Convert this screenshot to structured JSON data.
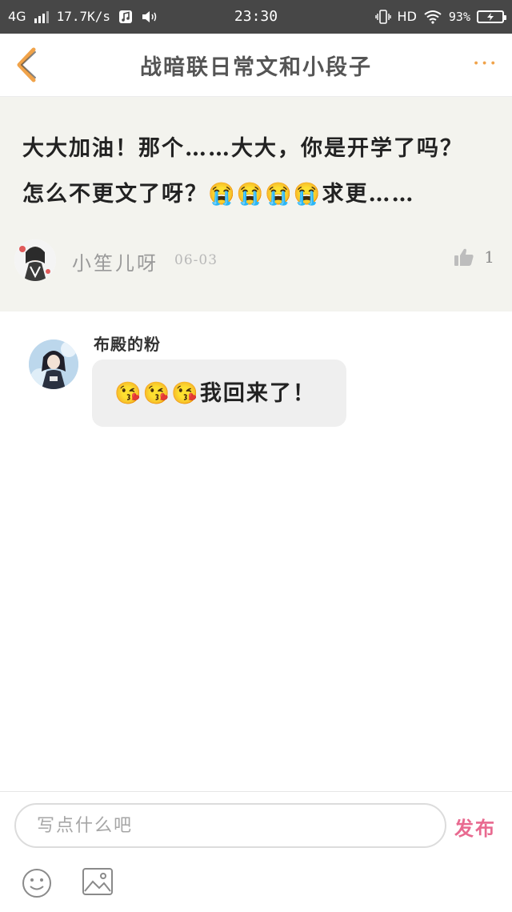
{
  "status_bar": {
    "network": "4G",
    "speed": "17.7K/s",
    "time": "23:30",
    "hd": "HD",
    "battery": "93%"
  },
  "header": {
    "title": "战暗联日常文和小段子",
    "more_label": "···"
  },
  "post": {
    "text_line1": "大大加油！那个……大大，你是开学了吗？",
    "text_line2": "怎么不更文了呀？😭😭😭😭求更……",
    "author": "小笙儿呀",
    "date": "06-03",
    "likes": "1"
  },
  "reply": {
    "name": "布殿的粉",
    "text": "😘😘😘我回来了！"
  },
  "composer": {
    "placeholder": "写点什么吧",
    "send_label": "发布"
  },
  "colors": {
    "accent_pink": "#e86a90",
    "accent_orange": "#f0a34a",
    "status_bar": "#474747",
    "post_bg": "#f3f3ee"
  },
  "icons": [
    "back-icon",
    "more-icon",
    "thumbs-up-icon",
    "emoji-icon",
    "image-icon",
    "wifi-icon",
    "vibrate-icon",
    "music-icon",
    "volume-icon",
    "battery-icon"
  ]
}
